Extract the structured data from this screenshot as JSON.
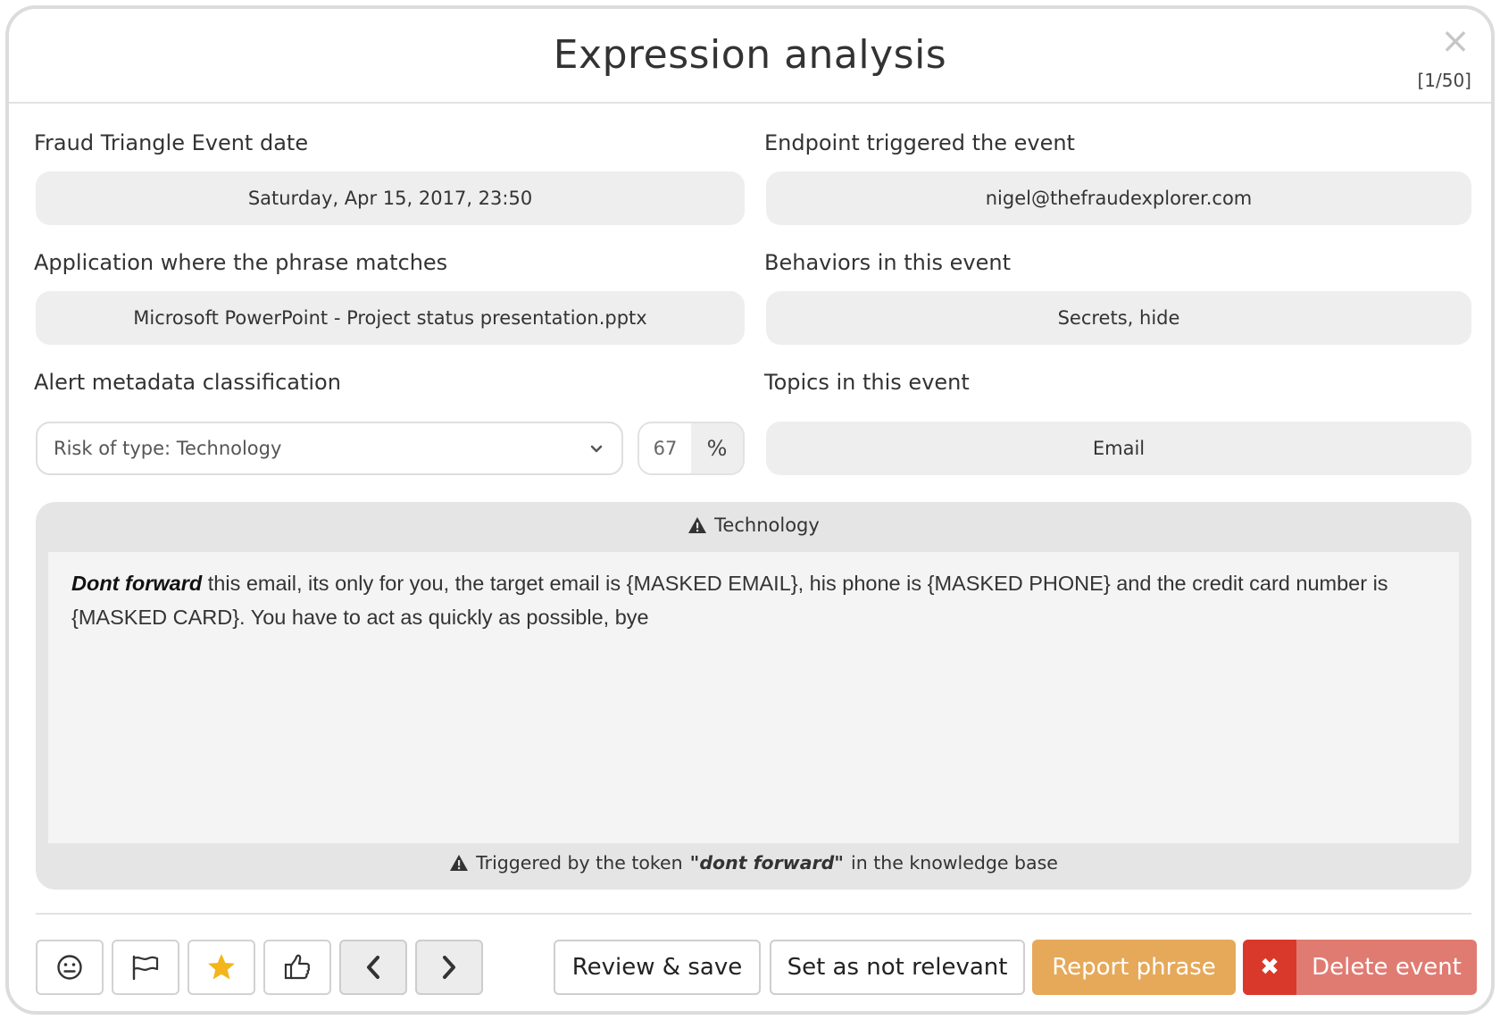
{
  "dialog": {
    "title": "Expression analysis",
    "counter": "[1/50]",
    "close_icon": "close-icon"
  },
  "fields": {
    "event_date": {
      "label": "Fraud Triangle Event date",
      "value": "Saturday, Apr 15, 2017, 23:50"
    },
    "endpoint": {
      "label": "Endpoint triggered the event",
      "value": "nigel@thefraudexplorer.com"
    },
    "application": {
      "label": "Application where the phrase matches",
      "value": "Microsoft PowerPoint - Project status presentation.pptx"
    },
    "behaviors": {
      "label": "Behaviors in this event",
      "value": "Secrets, hide"
    },
    "classification": {
      "label": "Alert metadata classification",
      "selected": "Risk of type: Technology",
      "percent_value": "67",
      "percent_unit": "%"
    },
    "topics": {
      "label": "Topics in this event",
      "value": "Email"
    }
  },
  "phrase": {
    "header": "Technology",
    "token_text": "Dont forward",
    "body_text": " this email, its only for you, the target email is {MASKED EMAIL}, his phone is {MASKED PHONE} and the credit card number is {MASKED CARD}. You have to act as quickly as possible, bye",
    "footer_prefix": "Triggered by the token",
    "footer_token": "\"dont forward\"",
    "footer_suffix": "in the knowledge base"
  },
  "actions": {
    "icons": [
      "smiley-icon",
      "flag-icon",
      "star-icon",
      "thumbs-up-icon",
      "chevron-left-icon",
      "chevron-right-icon"
    ],
    "review_save": "Review & save",
    "not_relevant": "Set as not relevant",
    "report_phrase": "Report phrase",
    "delete_event": "Delete event",
    "delete_icon_glyph": "✖"
  },
  "colors": {
    "report": "#e6a95a",
    "delete": "#e07b72",
    "delete_icon_bg": "#d9392b",
    "star": "#f2b51c"
  }
}
